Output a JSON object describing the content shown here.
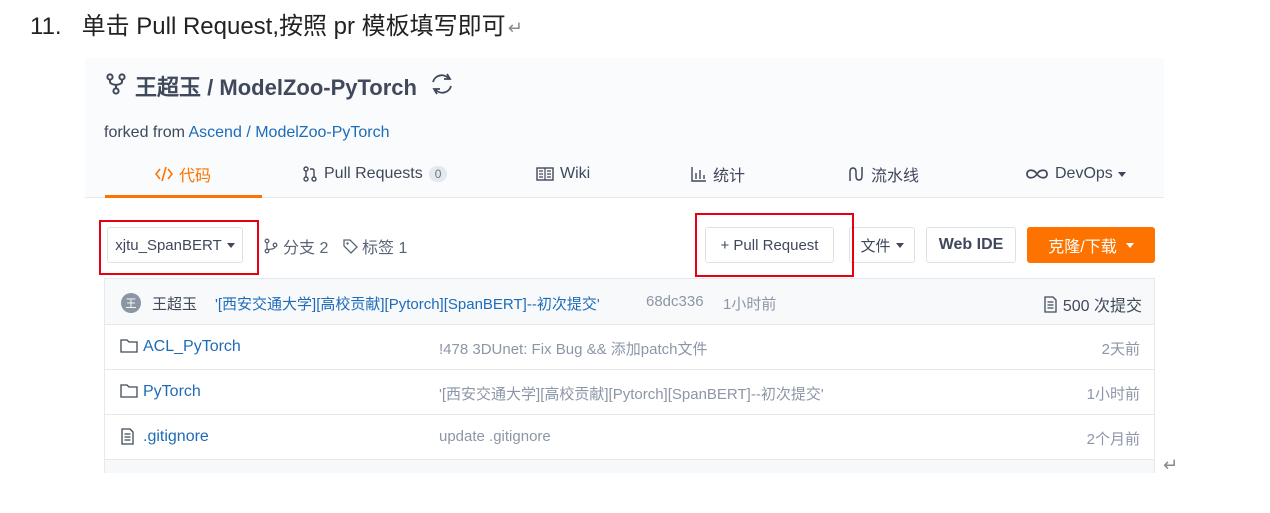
{
  "instruction": {
    "number": "11.",
    "text": "单击 Pull Request,按照 pr 模板填写即可",
    "return_mark": "↵"
  },
  "repo": {
    "owner": "王超玉",
    "separator": "/",
    "name": "ModelZoo-PyTorch",
    "forked_label": "forked from",
    "forked_owner": "Ascend",
    "forked_sep": "/",
    "forked_repo": "ModelZoo-PyTorch"
  },
  "tabs": [
    {
      "label": "代码",
      "icon": "code-icon",
      "active": true
    },
    {
      "label": "Pull Requests",
      "icon": "pull-request-icon",
      "badge": "0"
    },
    {
      "label": "Wiki",
      "icon": "wiki-icon"
    },
    {
      "label": "统计",
      "icon": "chart-icon"
    },
    {
      "label": "流水线",
      "icon": "pipeline-icon"
    },
    {
      "label": "DevOps",
      "icon": "infinity-icon",
      "dropdown": true
    }
  ],
  "toolbar": {
    "branch": "xjtu_SpanBERT",
    "branches_label": "分支 2",
    "tags_label": "标签 1",
    "pull_request_label": "+ Pull Request",
    "file_label": "文件",
    "webide_label": "Web IDE",
    "clone_label": "克隆/下载"
  },
  "commit": {
    "avatar": "王",
    "author": "王超玉",
    "message": "'[西安交通大学][高校贡献][Pytorch][SpanBERT]--初次提交'",
    "sha": "68dc336",
    "ago": "1小时前",
    "count": "500 次提交"
  },
  "files": [
    {
      "type": "folder",
      "name": "ACL_PyTorch",
      "message": "!478 3DUnet: Fix Bug && 添加patch文件",
      "time": "2天前"
    },
    {
      "type": "folder",
      "name": "PyTorch",
      "message": "'[西安交通大学][高校贡献][Pytorch][SpanBERT]--初次提交'",
      "time": "1小时前"
    },
    {
      "type": "file",
      "name": ".gitignore",
      "message": "update .gitignore",
      "time": "2个月前"
    }
  ],
  "colors": {
    "accent": "#fe7300",
    "link": "#1e6bb8",
    "highlight": "#e60012",
    "text": "#40485b"
  }
}
